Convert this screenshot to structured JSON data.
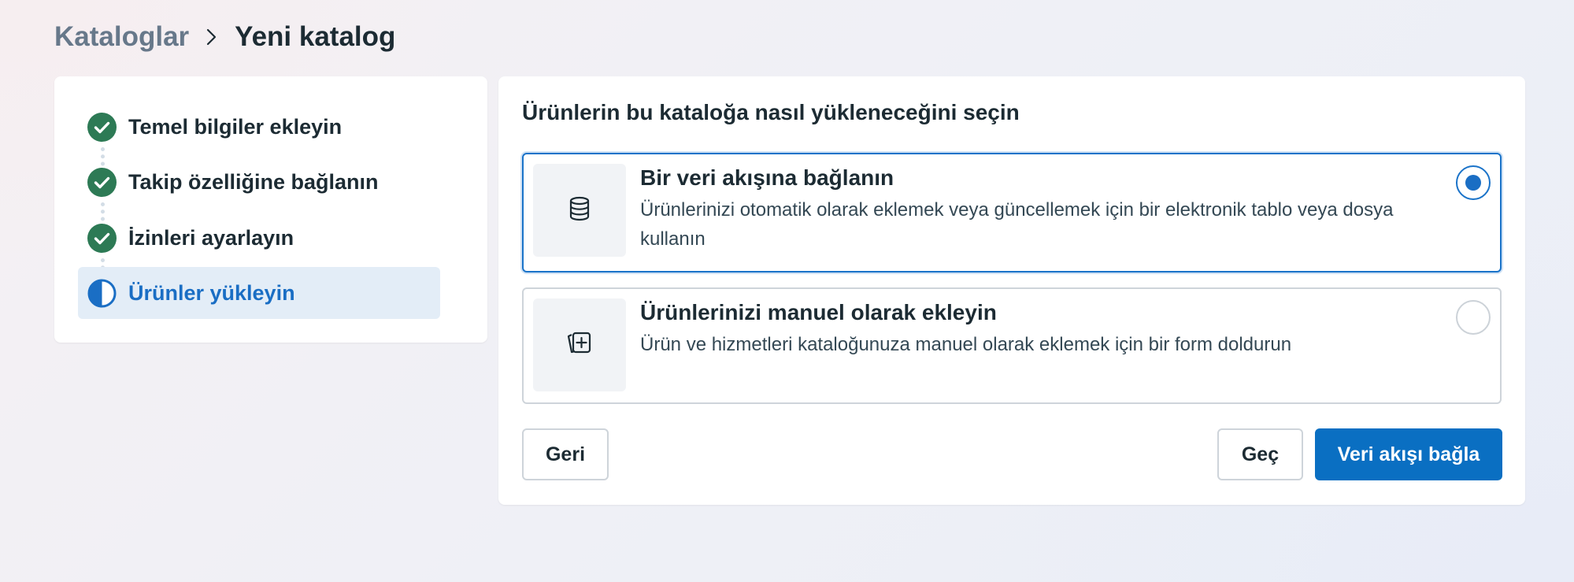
{
  "breadcrumb": {
    "parent": "Kataloglar",
    "separator_icon": "chevron-right-icon",
    "current": "Yeni katalog"
  },
  "steps": [
    {
      "label": "Temel bilgiler ekleyin",
      "status": "completed",
      "icon": "check-circle-icon"
    },
    {
      "label": "Takip özelliğine bağlanın",
      "status": "completed",
      "icon": "check-circle-icon"
    },
    {
      "label": "İzinleri ayarlayın",
      "status": "completed",
      "icon": "check-circle-icon"
    },
    {
      "label": "Ürünler yükleyin",
      "status": "in-progress",
      "icon": "half-circle-icon"
    }
  ],
  "main": {
    "title": "Ürünlerin bu kataloğa nasıl yükleneceğini seçin",
    "options": [
      {
        "title": "Bir veri akışına bağlanın",
        "description": "Ürünlerinizi otomatik olarak eklemek veya güncellemek için bir elektronik tablo veya dosya kullanın",
        "icon": "database-icon",
        "selected": true
      },
      {
        "title": "Ürünlerinizi manuel olarak ekleyin",
        "description": "Ürün ve hizmetleri kataloğunuza manuel olarak eklemek için bir form doldurun",
        "icon": "add-card-icon",
        "selected": false
      }
    ]
  },
  "buttons": {
    "back": "Geri",
    "skip": "Geç",
    "primary": "Veri akışı bağla"
  },
  "colors": {
    "accent": "#0a6fc2",
    "success": "#2d7a55",
    "active_step_bg": "#e3edf7",
    "active_step_text": "#1a6ec4"
  }
}
